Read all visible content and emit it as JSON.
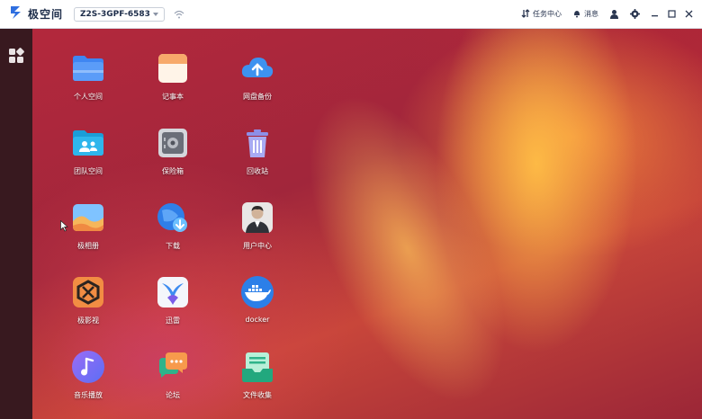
{
  "titlebar": {
    "brand": "极空间",
    "device": "Z2S-3GPF-6583",
    "task_center": "任务中心",
    "messages": "消息"
  },
  "desktop": {
    "apps": [
      {
        "label": "个人空间",
        "icon": "folder-icon"
      },
      {
        "label": "记事本",
        "icon": "notepad-icon"
      },
      {
        "label": "网盘备份",
        "icon": "cloud-upload-icon"
      },
      {
        "label": "团队空间",
        "icon": "team-folder-icon"
      },
      {
        "label": "保险箱",
        "icon": "safe-icon"
      },
      {
        "label": "回收站",
        "icon": "trash-icon"
      },
      {
        "label": "极相册",
        "icon": "photo-album-icon"
      },
      {
        "label": "下载",
        "icon": "download-icon"
      },
      {
        "label": "用户中心",
        "icon": "user-center-icon"
      },
      {
        "label": "极影视",
        "icon": "video-icon"
      },
      {
        "label": "迅雷",
        "icon": "thunder-icon"
      },
      {
        "label": "docker",
        "icon": "docker-icon"
      },
      {
        "label": "音乐播放",
        "icon": "music-icon"
      },
      {
        "label": "论坛",
        "icon": "forum-icon"
      },
      {
        "label": "文件收集",
        "icon": "file-collect-icon"
      }
    ]
  },
  "colors": {
    "accent": "#2f6fe0",
    "titlebar_bg": "#ffffff",
    "sidebar_bg": "#3c1c22"
  }
}
